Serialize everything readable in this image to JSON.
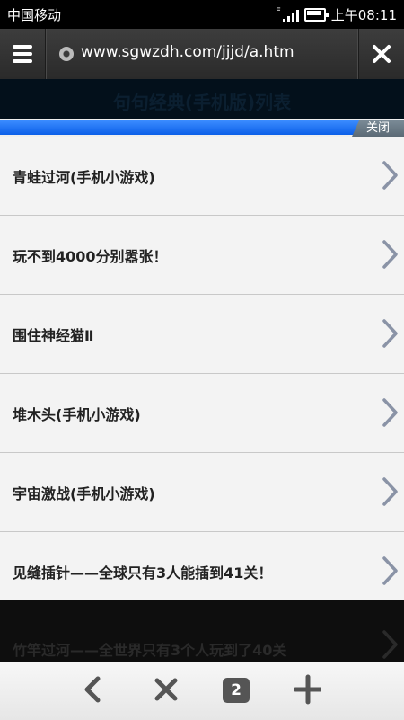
{
  "status_bar": {
    "carrier": "中国移动",
    "network": "E",
    "time": "上午08:11"
  },
  "url_bar": {
    "url": "www.sgwzdh.com/jjjd/a.htm"
  },
  "page": {
    "title": "句句经典(手机版)列表"
  },
  "panel": {
    "close_label": "关闭",
    "items": [
      {
        "label": "青蛙过河(手机小游戏)"
      },
      {
        "label": "玩不到4000分别嚣张！"
      },
      {
        "label": "围住神经猫Ⅱ"
      },
      {
        "label": "堆木头(手机小游戏)"
      },
      {
        "label": "宇宙激战(手机小游戏)"
      },
      {
        "label": "见缝插针——全球只有3人能插到41关！"
      }
    ]
  },
  "background_item": {
    "label": "竹竿过河——全世界只有3个人玩到了40关"
  },
  "bottom_bar": {
    "tab_count": "2"
  },
  "colors": {
    "accent_blue": "#0b5fe8",
    "toolbar": "#2f2f2f"
  }
}
